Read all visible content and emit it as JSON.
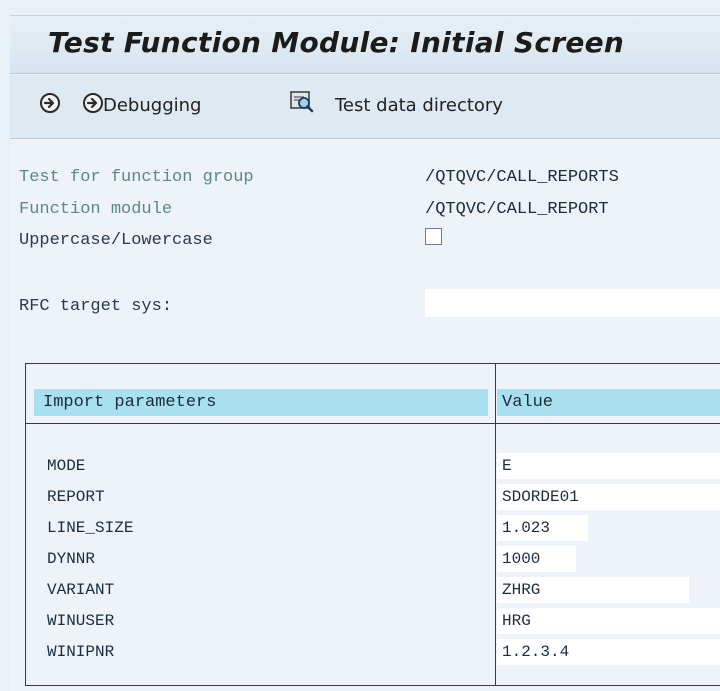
{
  "title": "Test Function Module: Initial Screen",
  "toolbar": {
    "execute_icon": "execute-icon",
    "debug_icon": "debug-icon",
    "debugging_label": "Debugging",
    "test_data_icon": "test-data-directory-icon",
    "test_data_label": "Test data directory"
  },
  "form": {
    "function_group_label": "Test for function group",
    "function_group_value": "/QTQVC/CALL_REPORTS",
    "function_module_label": "Function module",
    "function_module_value": "/QTQVC/CALL_REPORT",
    "uppercase_label": "Uppercase/Lowercase",
    "uppercase_checked": false,
    "rfc_label": "RFC target sys:",
    "rfc_value": ""
  },
  "params": {
    "header_name": "Import parameters",
    "header_value": "Value",
    "rows": [
      {
        "name": "MODE",
        "value": "E"
      },
      {
        "name": "REPORT",
        "value": "SDORDE01"
      },
      {
        "name": "LINE_SIZE",
        "value": "1.023"
      },
      {
        "name": "DYNNR",
        "value": "1000"
      },
      {
        "name": "VARIANT",
        "value": "ZHRG"
      },
      {
        "name": "WINUSER",
        "value": "HRG"
      },
      {
        "name": "WINIPNR",
        "value": "1.2.3.4"
      }
    ]
  },
  "colors": {
    "header_bg": "#a9e0f0",
    "label_teal": "#5a8a86",
    "background": "#edf3f8"
  }
}
